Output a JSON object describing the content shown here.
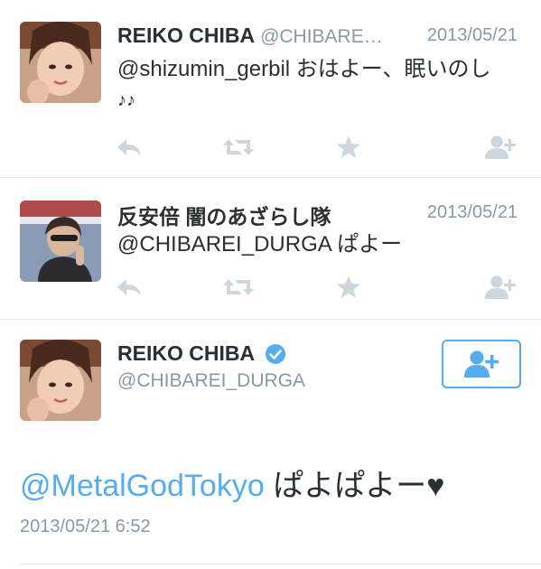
{
  "tweets": [
    {
      "name": "REIKO CHIBA",
      "handle": "@CHIBARE…",
      "time": "2013/05/21",
      "text_line1": "@shizumin_gerbil おはよー、眠いのし",
      "text_line2": "♪♪"
    },
    {
      "name": "反安倍 闇のあざらし隊",
      "time": "2013/05/21",
      "text_line1": "@CHIBAREI_DURGA ぱよー"
    }
  ],
  "detail": {
    "name": "REIKO CHIBA",
    "handle": "@CHIBAREI_DURGA",
    "mention": "@MetalGodTokyo",
    "text": " ぱよぱよー♥",
    "timestamp": "2013/05/21 6:52"
  },
  "icons": {
    "reply": "reply-icon",
    "retweet": "retweet-icon",
    "favorite": "star-icon",
    "follow": "add-user-icon",
    "verified": "verified-badge-icon"
  },
  "colors": {
    "icon_gray": "#ccd6dd",
    "accent": "#55acee",
    "secondary_text": "#8899a6"
  }
}
